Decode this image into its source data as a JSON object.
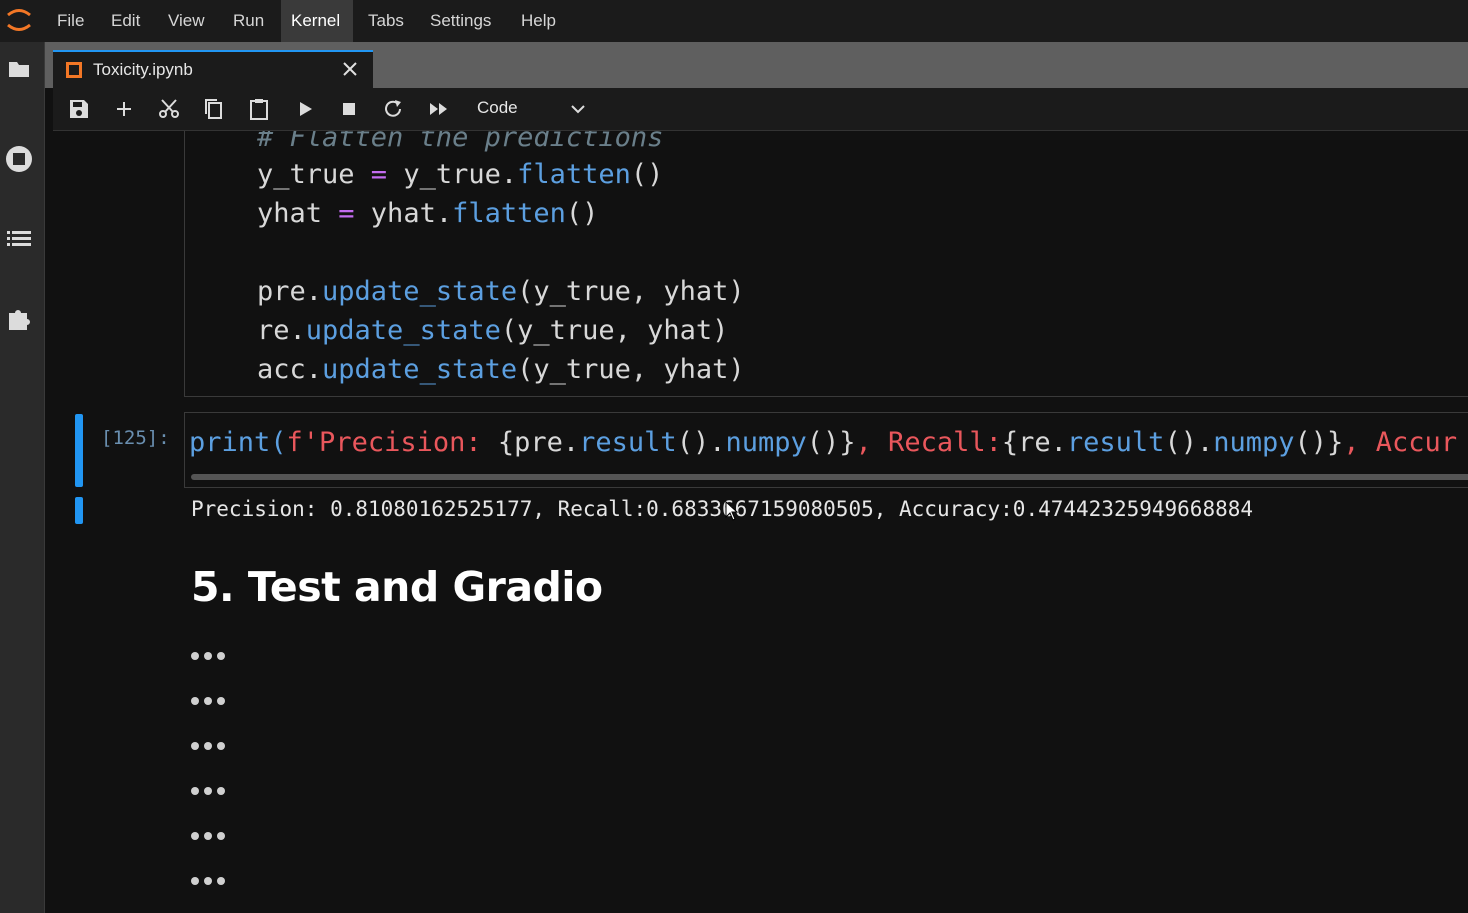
{
  "menubar": {
    "items": [
      "File",
      "Edit",
      "View",
      "Run",
      "Kernel",
      "Tabs",
      "Settings",
      "Help"
    ],
    "active": "Kernel"
  },
  "sidebar": {
    "icons": [
      "folder-icon",
      "running-icon",
      "toc-icon",
      "extension-icon"
    ]
  },
  "tab": {
    "title": "Toxicity.ipynb"
  },
  "toolbar": {
    "cell_type": "Code"
  },
  "cell1": {
    "lines": [
      "# Flatten the predictions",
      "y_true = y_true.flatten()",
      "yhat = yhat.flatten()",
      "",
      "pre.update_state(y_true, yhat)",
      "re.update_state(y_true, yhat)",
      "acc.update_state(y_true, yhat)"
    ]
  },
  "cell2": {
    "prompt": "[125]:",
    "code_parts": {
      "p1": "print(",
      "p2": "f'Precision: ",
      "p3": "{pre.",
      "p4": "result",
      "p5": "().",
      "p6": "numpy",
      "p7": "()}",
      "p8": ", Recall:",
      "p9": "{re.",
      "p10": "result",
      "p11": "().",
      "p12": "numpy",
      "p13": "()}",
      "p14": ", Accur"
    },
    "output": "Precision: 0.81080162525177, Recall:0.6833667159080505, Accuracy:0.47442325949668884"
  },
  "markdown": {
    "heading": "5. Test and Gradio"
  },
  "collapsed_cells": 6,
  "colors": {
    "accent": "#2196f3",
    "function": "#5c9fe0",
    "operator": "#c36cf0",
    "string": "#e9575c"
  }
}
